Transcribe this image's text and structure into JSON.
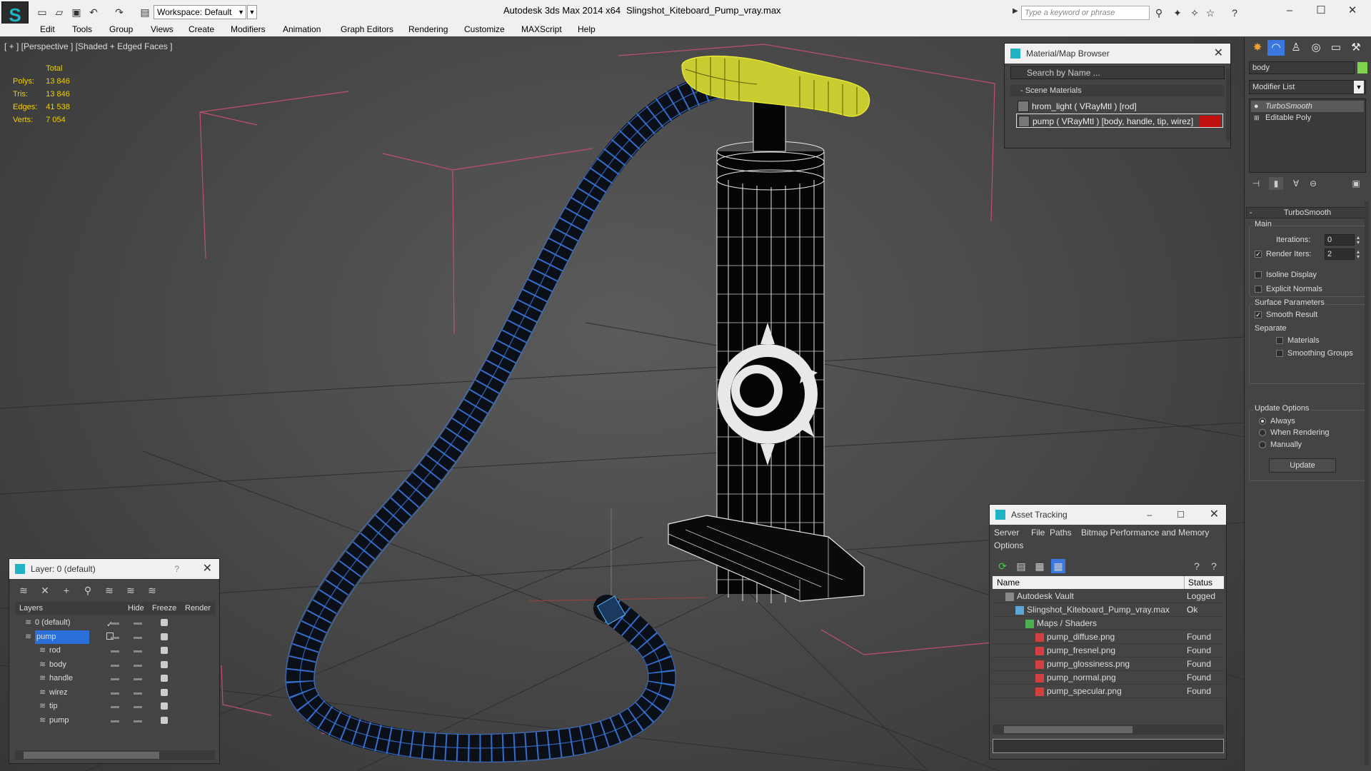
{
  "titlebar": {
    "workspace_label": "Workspace: Default",
    "app_title": "Autodesk 3ds Max  2014 x64",
    "document_title": "Slingshot_Kiteboard_Pump_vray.max",
    "search_placeholder": "Type a keyword or phrase"
  },
  "menu": [
    "Edit",
    "Tools",
    "Group",
    "Views",
    "Create",
    "Modifiers",
    "Animation",
    "Graph Editors",
    "Rendering",
    "Customize",
    "MAXScript",
    "Help"
  ],
  "viewport": {
    "label": "[ + ] [Perspective ] [Shaded + Edged Faces ]",
    "stats": {
      "header": "Total",
      "rows": [
        {
          "label": "Polys:",
          "value": "13 846"
        },
        {
          "label": "Tris:",
          "value": "13 846"
        },
        {
          "label": "Edges:",
          "value": "41 538"
        },
        {
          "label": "Verts:",
          "value": "7 054"
        }
      ]
    }
  },
  "material_browser": {
    "title": "Material/Map Browser",
    "search_placeholder": "Search by Name ...",
    "section": "- Scene Materials",
    "materials": [
      {
        "name": "hrom_light  ( VRayMtl )  [rod]"
      },
      {
        "name": "pump  ( VRayMtl )  [body, handle, tip, wirez]"
      }
    ]
  },
  "layer_panel": {
    "title": "Layer: 0 (default)",
    "help": "?",
    "columns": [
      "Layers",
      "Hide",
      "Freeze",
      "Render"
    ],
    "rows": [
      {
        "name": "0 (default)",
        "indent": 1,
        "selected": false,
        "check": "✓"
      },
      {
        "name": "pump",
        "indent": 1,
        "selected": true,
        "check": ""
      },
      {
        "name": "rod",
        "indent": 2,
        "selected": false,
        "check": ""
      },
      {
        "name": "body",
        "indent": 2,
        "selected": false,
        "check": ""
      },
      {
        "name": "handle",
        "indent": 2,
        "selected": false,
        "check": ""
      },
      {
        "name": "wirez",
        "indent": 2,
        "selected": false,
        "check": ""
      },
      {
        "name": "tip",
        "indent": 2,
        "selected": false,
        "check": ""
      },
      {
        "name": "pump",
        "indent": 2,
        "selected": false,
        "check": ""
      }
    ]
  },
  "asset_tracking": {
    "title": "Asset Tracking",
    "menu": [
      "Server",
      "File",
      "Paths",
      "Bitmap Performance and Memory",
      "Options"
    ],
    "columns": [
      "Name",
      "Status"
    ],
    "rows": [
      {
        "name": "Autodesk Vault",
        "status": "Logged O",
        "indent": 1
      },
      {
        "name": "Slingshot_Kiteboard_Pump_vray.max",
        "status": "Ok",
        "indent": 2
      },
      {
        "name": "Maps / Shaders",
        "status": "",
        "indent": 3
      },
      {
        "name": "pump_diffuse.png",
        "status": "Found",
        "indent": 4
      },
      {
        "name": "pump_fresnel.png",
        "status": "Found",
        "indent": 4
      },
      {
        "name": "pump_glossiness.png",
        "status": "Found",
        "indent": 4
      },
      {
        "name": "pump_normal.png",
        "status": "Found",
        "indent": 4
      },
      {
        "name": "pump_specular.png",
        "status": "Found",
        "indent": 4
      }
    ]
  },
  "command_panel": {
    "object_name": "body",
    "object_color": "#7dd34a",
    "modifier_list_label": "Modifier List",
    "stack": [
      "TurboSmooth",
      "Editable Poly"
    ],
    "rollout_title": "TurboSmooth",
    "main_group": "Main",
    "iterations_label": "Iterations:",
    "iterations_value": "0",
    "render_iters_label": "Render Iters:",
    "render_iters_value": "2",
    "isoline_label": "Isoline Display",
    "explicit_normals_label": "Explicit Normals",
    "surface_group": "Surface Parameters",
    "smooth_result_label": "Smooth Result",
    "separate_label": "Separate",
    "materials_label": "Materials",
    "smoothing_groups_label": "Smoothing Groups",
    "update_group": "Update Options",
    "always_label": "Always",
    "when_rendering_label": "When Rendering",
    "manually_label": "Manually",
    "update_button": "Update"
  }
}
